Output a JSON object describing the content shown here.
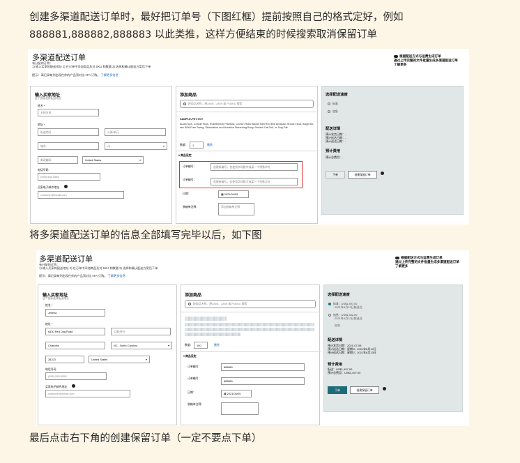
{
  "captions": {
    "intro_line1": "创建多渠道配送订单时，最好把订单号（下图红框）提前按照自己的格式定好，例如",
    "intro_line2": "888881,888882,888883 以此类推，这样方便结束的时候搜索取消保留订单",
    "middle": "将多渠道配送订单的信息全部填写完毕以后，如下图",
    "final": "最后点击右下角的创建保留订单（一定不要点下单）"
  },
  "form": {
    "page_title": "多渠道配送订单",
    "sub_line1": "有分配的订购：",
    "sub_line2": "1) 输入买家的配送地址 2) 在订单中添加商品及对 SKU 和数量 3) 选择和确认配送方案后下单",
    "tip": "提示：请记录每列出现在你的产品顶对比 eFA 订购。",
    "tip_link": "了解更多信息",
    "right_note_line1": "根据配送方式与运费生成订单",
    "right_note_line2": "通过上传完整的文件批量生成多渠道配送订单",
    "right_note_line3": "了解更多",
    "address": {
      "title": "输入买家地址",
      "subtitle": "这个国家选择配送地址",
      "name_label": "姓名 *",
      "address_label": "地址 *",
      "phone_label": "电话号码",
      "email_label": "买家电子邮件地址",
      "country_value": "United States"
    },
    "products": {
      "title": "添加商品",
      "search_placeholder": "按商品名称、原ASIN、ASIN 或 FNSKU 搜索",
      "qty_label": "数量：",
      "qty_value": "1",
      "remove_label": "删除",
      "order_info_label": "▾ 商品设定",
      "order_no_label": "订单编号：",
      "order_no_label2": "订单编号：",
      "shipping_note_label": "装箱单注释：",
      "date_label": "日期：",
      "note_label": "装箱单注释："
    },
    "shipping": {
      "title": "选择配送速度",
      "opt1": "标准",
      "opt2": "加急",
      "details_title": "配送详情",
      "detail_line1": "预计发货日期：-",
      "detail_line2": "预计送达日期：-",
      "detail_line3": "预计送达日期：-",
      "cost_title": "预计费用",
      "cost_line": "预计总费用：-",
      "place_order_button": "下单",
      "hold_order_button": "创建保留订单"
    }
  },
  "shot1": {
    "name_placeholder": "名称名称",
    "addr1_placeholder": "街道地址",
    "addr2_placeholder": "公寓/单元",
    "city_placeholder": "城市",
    "state_placeholder": "州",
    "zip_placeholder": "邮政编码",
    "phone_placeholder": "(555) 555-5555",
    "email_placeholder": "customer@email.com",
    "product_sku": "SAMPLE-PET-TOY",
    "product_desc": "Audio toys, Crinkle Hoot, Rubberneck Plantoid, Crunch Rolls Biscuit Bell Red Elle Abrasion Shock Inbut, Bright fur, sex BPA Free Swing, Stimulation and Nutrition Stretching Body, Perfect Cat Doll, or Dog Gift",
    "order_no_placeholder": "创建新编号，仅使用字母数字或某一个特殊字符",
    "order_no2_placeholder": "创建新编号，仅使用字母数字或某一个特殊字符",
    "date_value": "2021/04/05",
    "note_placeholder": "添加装箱单注释"
  },
  "shot2": {
    "name_value": "Jellena",
    "addr1_value": "6430 Red Dog Road",
    "addr2_placeholder": "公寓/单元",
    "city_value": "Charlotte",
    "state_value": "NC - North Carolina",
    "zip_value": "28223",
    "phone_placeholder": "(555) 555-5555",
    "email_placeholder": "customer@email.com",
    "qty_value": "100",
    "order_no_value": "888881",
    "order_no2_value": "888881",
    "date_value": "2021/04/05",
    "opt1_price": "标准：US$1,497.00",
    "opt1_date": "2021年4月13日前送达",
    "opt2_price": "加急：US$1,532.00",
    "opt2_date": "2021年4月12日前送达",
    "opt3": "加急",
    "detail_line1": "预计发货日期：2021-07-08",
    "detail_line2": "预计送达日期：星期二, 2021年8月10日",
    "detail_line3": "预计送达日期：星期三, 2021年8月13日",
    "cost_line1": "配送：US$1,497.00",
    "cost_line2": "预计总费用：US$1,497.00"
  },
  "colors": {
    "primary": "#1d6b78",
    "highlight": "#e0302a",
    "background": "#fdf5e6"
  }
}
